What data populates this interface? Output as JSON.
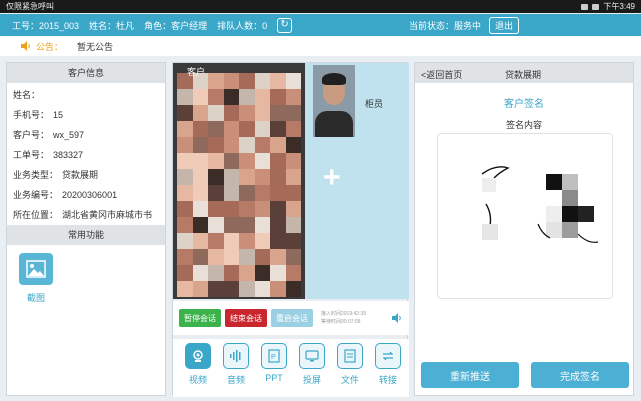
{
  "status_bar": {
    "left": "仅限紧急呼叫",
    "time": "下午3:49"
  },
  "header": {
    "agent_id_label": "工号：2015_003",
    "name_label": "姓名：杜凡",
    "role_label": "角色：客户经理",
    "queue_label": "排队人数：0",
    "current_status_label": "当前状态：服务中",
    "exit_label": "退出"
  },
  "notice": {
    "label": "公告：",
    "text": "暂无公告"
  },
  "left_panel": {
    "title": "客户信息",
    "fields": [
      {
        "key": "姓名：",
        "value": ""
      },
      {
        "key": "手机号：",
        "value": "15"
      },
      {
        "key": "客户号：",
        "value": "wx_597"
      },
      {
        "key": "工单号：",
        "value": "383327"
      },
      {
        "key": "业务类型：",
        "value": "贷款展期"
      },
      {
        "key": "业务编号：",
        "value": "20200306001"
      },
      {
        "key": "所在位置：",
        "value": "湖北省黄冈市麻城市书"
      }
    ],
    "tools_title": "常用功能",
    "screenshot_label": "截图"
  },
  "video": {
    "customer_label": "客户",
    "agent_label": "柜员",
    "pause_label": "暂停会话",
    "end_label": "结束会话",
    "restart_label": "重启会话",
    "connect_time": "接入时间2019:42:39",
    "wait_time": "等待时间00:07:09"
  },
  "functions": [
    {
      "label": "视频",
      "icon": "camera-icon"
    },
    {
      "label": "音频",
      "icon": "audio-wave-icon"
    },
    {
      "label": "PPT",
      "icon": "ppt-icon"
    },
    {
      "label": "投屏",
      "icon": "cast-screen-icon"
    },
    {
      "label": "文件",
      "icon": "file-icon"
    },
    {
      "label": "转接",
      "icon": "transfer-icon"
    }
  ],
  "right_panel": {
    "back_label": "<返回首页",
    "title": "贷款展期",
    "sign_title": "客户签名",
    "sign_content_label": "签名内容",
    "resend_label": "重新推送",
    "finish_label": "完成签名"
  },
  "colors": {
    "accent": "#3aa6c8",
    "pause": "#3bb24a",
    "end": "#c9272d",
    "notice": "#e8a21b"
  }
}
